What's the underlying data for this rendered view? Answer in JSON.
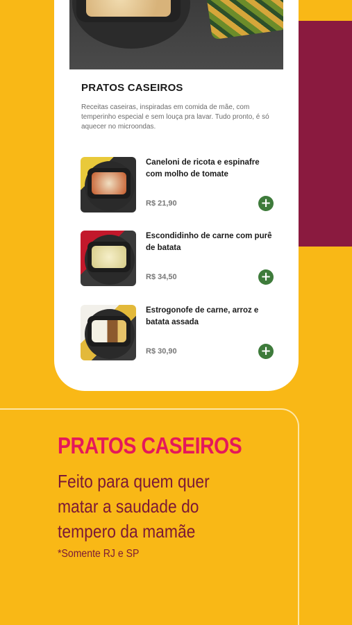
{
  "section": {
    "title": "PRATOS CASEIROS",
    "description": "Receitas caseiras, inspiradas em comida de mãe, com temperinho especial e sem louça pra lavar. Tudo pronto, é só aquecer no microondas."
  },
  "items": [
    {
      "name": "Caneloni de ricota e espinafre com molho de tomate",
      "price": "R$ 21,90",
      "add_label": "+"
    },
    {
      "name": "Escondidinho de carne com purê de batata",
      "price": "R$ 34,50",
      "add_label": "+"
    },
    {
      "name": "Estrogonofe de carne, arroz e batata assada",
      "price": "R$ 30,90",
      "add_label": "+"
    }
  ],
  "promo": {
    "title": "PRATOS CASEIROS",
    "subtitle": "Feito para quem quer matar a saudade do tempero da mamãe",
    "note": "*Somente RJ e SP"
  },
  "colors": {
    "background": "#F9B816",
    "band": "#8A1A3F",
    "add_button": "#3E7B3B",
    "promo_title": "#E5185A",
    "promo_text": "#7B1836"
  },
  "icons": {
    "add": "plus-circle-icon"
  }
}
